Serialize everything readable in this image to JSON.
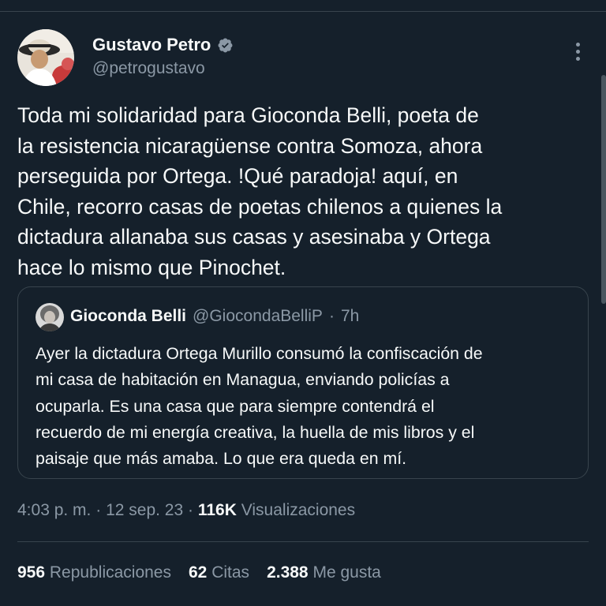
{
  "tweet": {
    "author": {
      "name": "Gustavo Petro",
      "handle": "@petrogustavo",
      "verified_icon": "verified-badge-icon"
    },
    "text": "Toda mi solidaridad para Gioconda Belli, poeta de\nla resistencia nicaragüense contra Somoza, ahora\nperseguida por Ortega. !Qué paradoja! aquí, en\nChile, recorro casas de poetas chilenos a quienes la\ndictadura allanaba sus casas y asesinaba y Ortega\nhace lo mismo que Pinochet.",
    "quoted": {
      "name": "Gioconda Belli",
      "handle": "@GiocondaBelliP",
      "separator": "·",
      "time": "7h",
      "text": "Ayer la dictadura Ortega Murillo consumó la confiscación de\nmi casa de habitación en Managua, enviando policías a\nocuparla. Es una casa que para siempre contendrá el\nrecuerdo de mi energía creativa, la huella de mis libros y el\npaisaje que más amaba. Lo que era queda en mí."
    },
    "meta": {
      "time": "4:03 p. m.",
      "sep1": "·",
      "date": "12 sep. 23",
      "sep2": "·",
      "views_count": "116K",
      "views_label": "Visualizaciones"
    },
    "stats": [
      {
        "count": "956",
        "label": "Republicaciones"
      },
      {
        "count": "62",
        "label": "Citas"
      },
      {
        "count": "2.388",
        "label": "Me gusta"
      }
    ]
  },
  "colors": {
    "background": "#15202b",
    "text": "#f7f9f9",
    "secondary": "#8b98a5",
    "border": "#38444d",
    "verified": "#8b98a5"
  }
}
